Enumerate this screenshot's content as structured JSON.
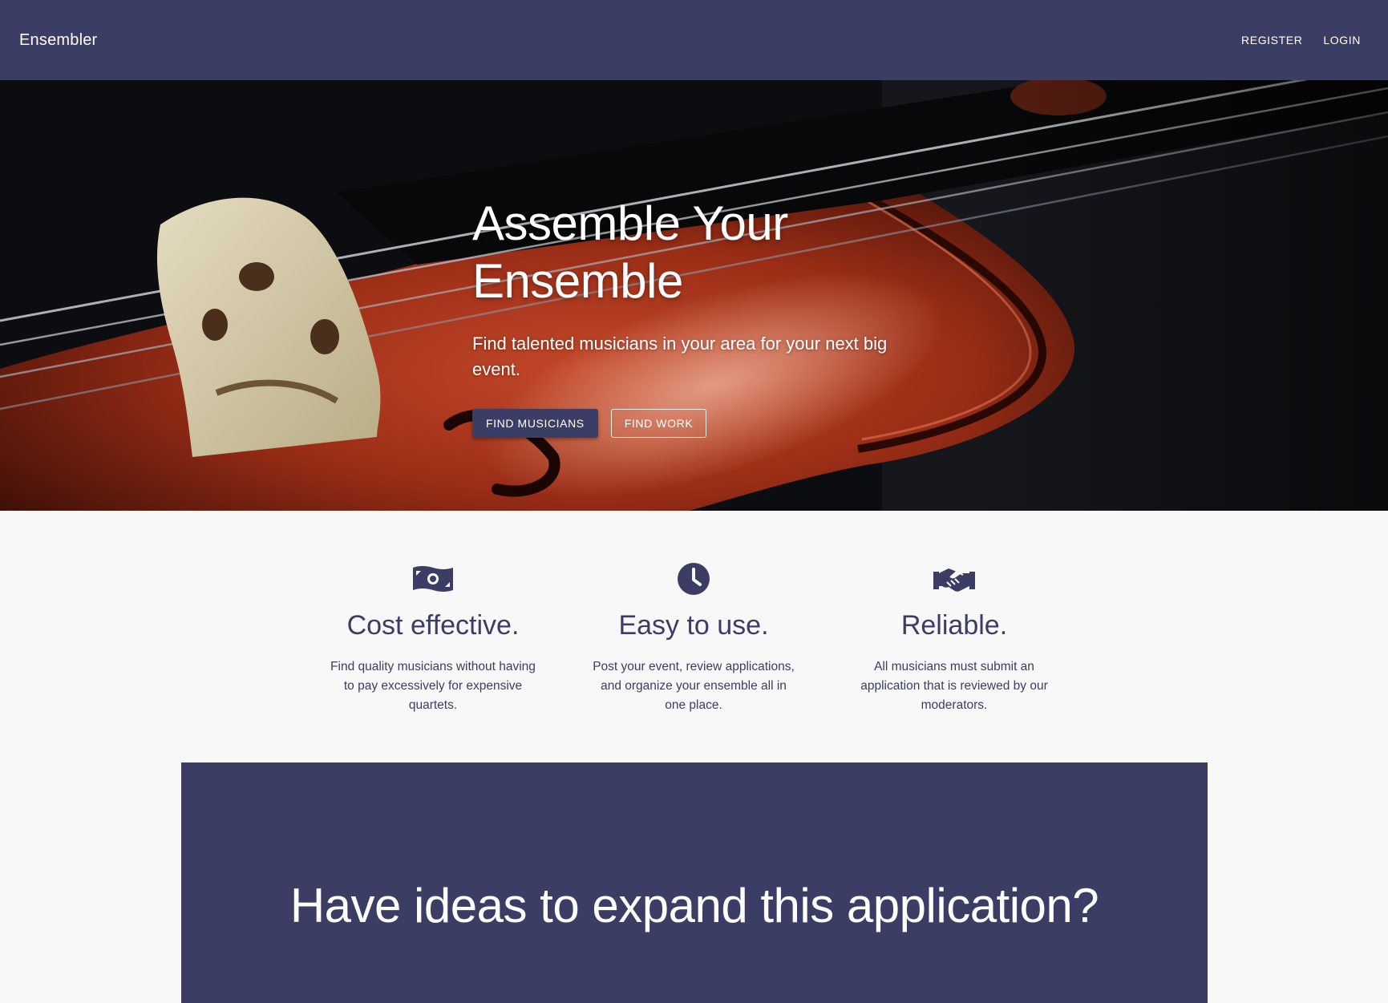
{
  "header": {
    "brand": "Ensembler",
    "nav": [
      {
        "label": "REGISTER"
      },
      {
        "label": "LOGIN"
      }
    ]
  },
  "hero": {
    "title": "Assemble Your Ensemble",
    "subtitle": "Find talented musicians in your area for your next big event.",
    "buttons": {
      "primary": "FIND MUSICIANS",
      "secondary": "FIND WORK"
    }
  },
  "features": [
    {
      "icon": "money-bill-icon",
      "title": "Cost effective.",
      "text": "Find quality musicians without having to pay excessively for expensive quartets."
    },
    {
      "icon": "clock-icon",
      "title": "Easy to use.",
      "text": "Post your event, review applications, and organize your ensemble all in one place."
    },
    {
      "icon": "handshake-icon",
      "title": "Reliable.",
      "text": "All musicians must submit an application that is reviewed by our moderators."
    }
  ],
  "contribute": {
    "title": "Have ideas to expand this application?"
  },
  "colors": {
    "primary": "#3c3d64",
    "background": "#f8f8f8",
    "on_primary": "#ffffff"
  }
}
